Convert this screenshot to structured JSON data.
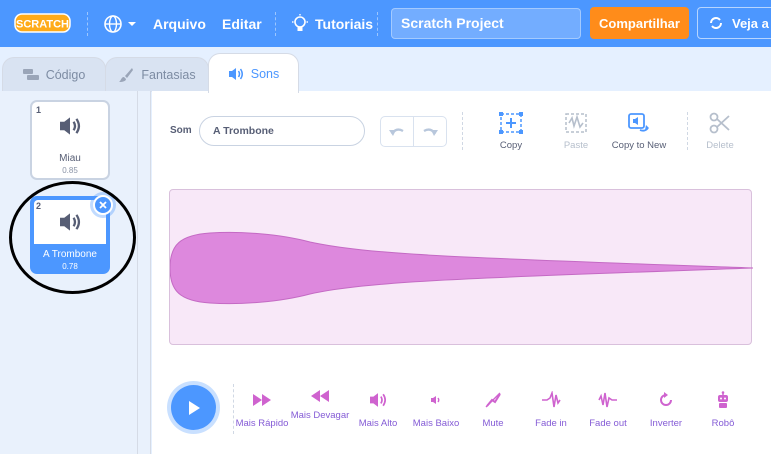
{
  "menu": {
    "logo_text": "SCRATCH",
    "language_icon": "globe-icon",
    "file_label": "Arquivo",
    "edit_label": "Editar",
    "tutorials_label": "Tutoriais",
    "project_title": "Scratch Project",
    "share_label": "Compartilhar",
    "see_page_label": "Veja a"
  },
  "tabs": [
    {
      "label": "Código",
      "icon": "code-blocks-icon"
    },
    {
      "label": "Fantasias",
      "icon": "paintbrush-icon"
    },
    {
      "label": "Sons",
      "icon": "speaker-icon"
    }
  ],
  "sounds": [
    {
      "number": "1",
      "name": "Miau",
      "duration": "0.85",
      "selected": false
    },
    {
      "number": "2",
      "name": "A Trombone",
      "duration": "0.78",
      "selected": true
    }
  ],
  "editor": {
    "sound_label": "Som",
    "sound_name": "A Trombone",
    "tools": [
      {
        "label": "Copy",
        "icon": "copy-icon",
        "enabled": true
      },
      {
        "label": "Paste",
        "icon": "paste-icon",
        "enabled": false
      },
      {
        "label": "Copy to New",
        "icon": "copy-to-new-icon",
        "enabled": true
      },
      {
        "label": "Delete",
        "icon": "scissors-icon",
        "enabled": false
      }
    ]
  },
  "effects": [
    {
      "label": "Mais Rápido",
      "icon": "fast-forward-icon"
    },
    {
      "label": "Mais Devagar",
      "icon": "rewind-icon"
    },
    {
      "label": "Mais Alto",
      "icon": "louder-icon"
    },
    {
      "label": "Mais Baixo",
      "icon": "softer-icon"
    },
    {
      "label": "Mute",
      "icon": "mute-icon"
    },
    {
      "label": "Fade in",
      "icon": "fade-in-icon"
    },
    {
      "label": "Fade out",
      "icon": "fade-out-icon"
    },
    {
      "label": "Inverter",
      "icon": "reverse-icon"
    },
    {
      "label": "Robô",
      "icon": "robot-icon"
    }
  ],
  "colors": {
    "menu_blue": "#4c97ff",
    "share_orange": "#ff8c1a",
    "waveform_fill": "#dd88dd",
    "effect_purple": "#cf63cf"
  }
}
